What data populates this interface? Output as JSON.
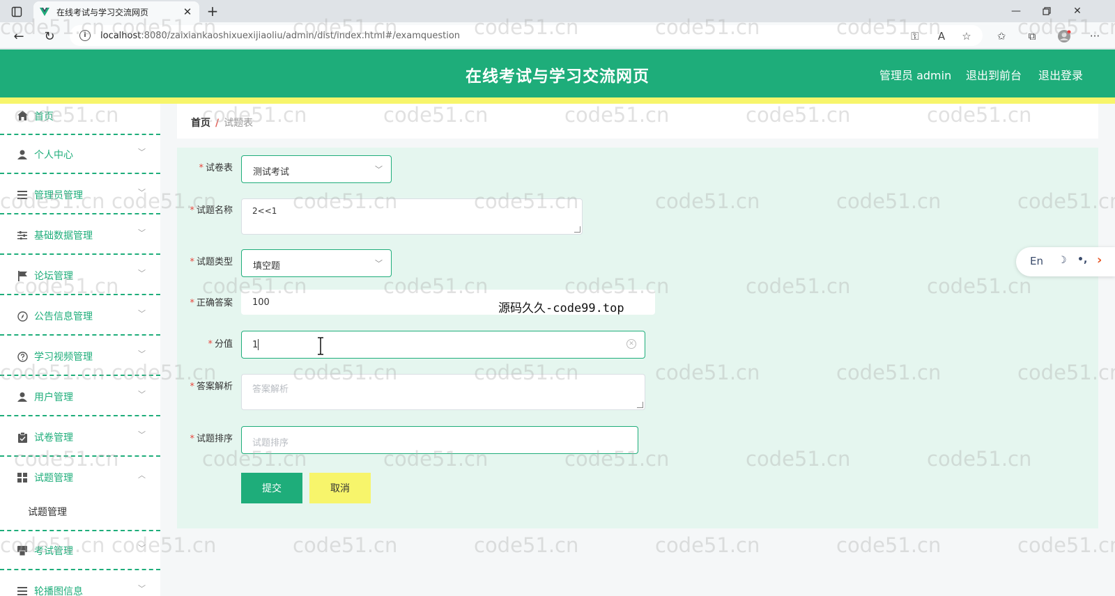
{
  "browser": {
    "tab_title": "在线考试与学习交流网页",
    "url_host": "localhost",
    "url_path": ":8080/zaixiankaoshixuexijiaoliu/admin/dist/index.html#/examquestion"
  },
  "header": {
    "title": "在线考试与学习交流网页",
    "user_label": "管理员 admin",
    "to_front": "退出到前台",
    "logout": "退出登录"
  },
  "sidebar": {
    "items": [
      {
        "label": "首页",
        "icon": "home-icon"
      },
      {
        "label": "个人中心",
        "icon": "user-icon"
      },
      {
        "label": "管理员管理",
        "icon": "list-icon"
      },
      {
        "label": "基础数据管理",
        "icon": "sliders-icon"
      },
      {
        "label": "论坛管理",
        "icon": "flag-icon"
      },
      {
        "label": "公告信息管理",
        "icon": "compass-icon"
      },
      {
        "label": "学习视频管理",
        "icon": "help-circle-icon"
      },
      {
        "label": "用户管理",
        "icon": "user-icon"
      },
      {
        "label": "试卷管理",
        "icon": "clipboard-icon"
      },
      {
        "label": "试题管理",
        "icon": "grid-icon"
      }
    ],
    "sub_item": "试题管理",
    "bottom_items": [
      {
        "label": "考试管理",
        "icon": "printer-icon"
      },
      {
        "label": "轮播图信息",
        "icon": "list-icon"
      }
    ]
  },
  "breadcrumb": {
    "home": "首页",
    "separator": "/",
    "current": "试题表"
  },
  "form": {
    "paper_label": "试卷表",
    "paper_value": "测试考试",
    "name_label": "试题名称",
    "name_value": "2<<1",
    "type_label": "试题类型",
    "type_value": "填空题",
    "answer_label": "正确答案",
    "answer_value": "100",
    "score_label": "分值",
    "score_value": "1",
    "analysis_label": "答案解析",
    "analysis_placeholder": "答案解析",
    "order_label": "试题排序",
    "order_placeholder": "试题排序",
    "required_mark": "*",
    "submit": "提交",
    "cancel": "取消"
  },
  "overlay": {
    "code99": "源码久久-code99.top",
    "watermark": "code51.cn",
    "translator_lang": "En"
  },
  "colors": {
    "primary": "#1ead7a",
    "accent_yellow": "#f7f56b",
    "required": "#e8453c",
    "panel_bg": "#e5f6ef"
  }
}
